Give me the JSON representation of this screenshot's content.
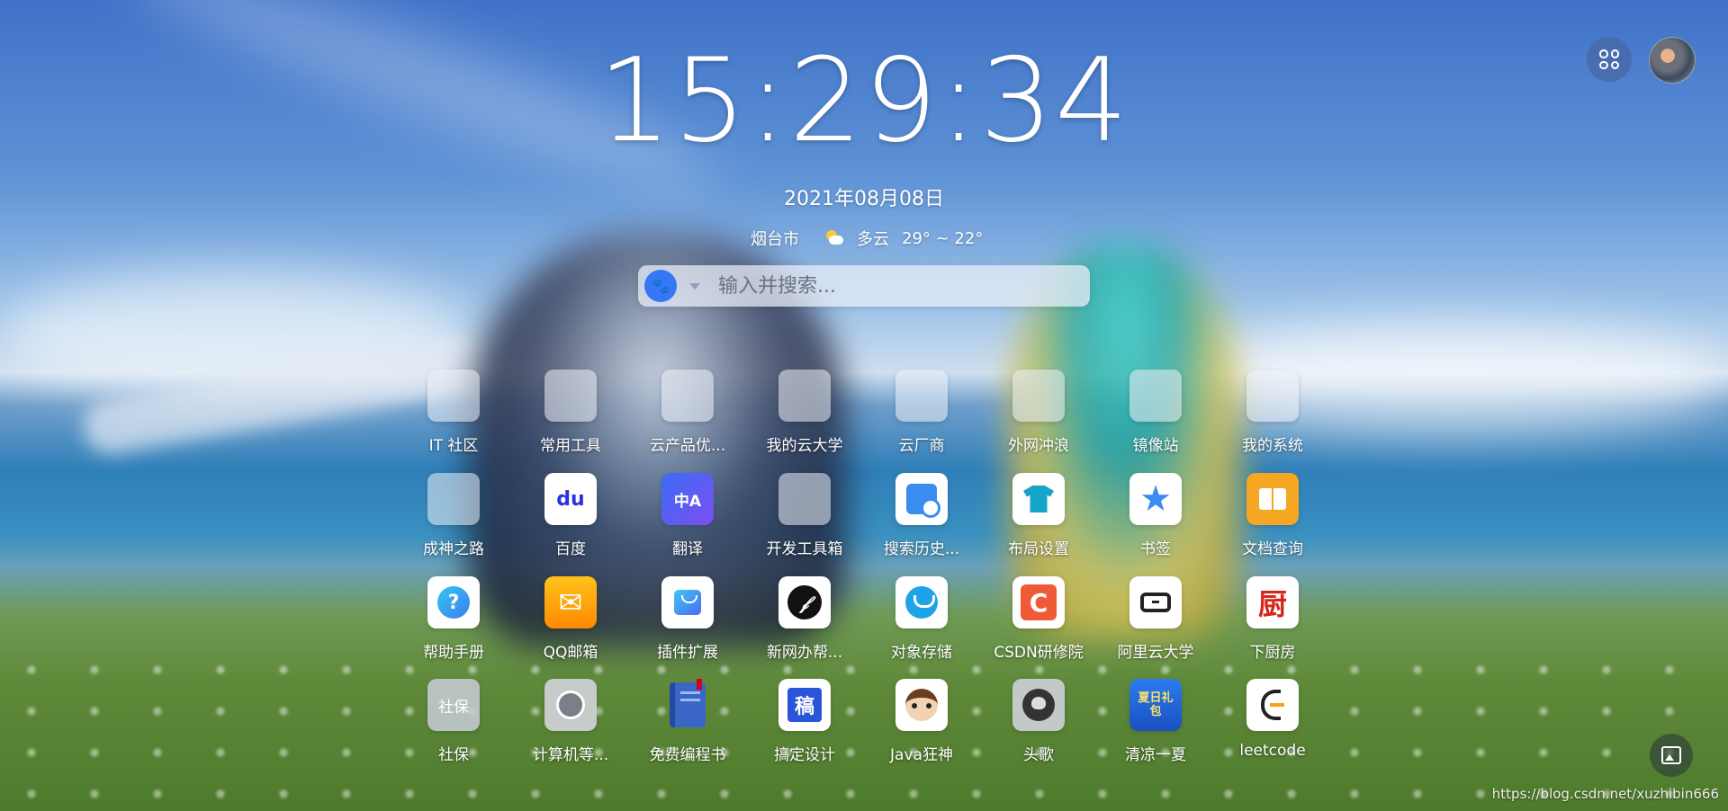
{
  "clock": {
    "time": "15:29:34"
  },
  "date": "2021年08月08日",
  "weather": {
    "city": "烟台市",
    "condition": "多云",
    "temps": "29° ~ 22°",
    "icon": "partly-cloudy-icon"
  },
  "search": {
    "placeholder": "输入并搜索...",
    "value": "",
    "engine_icon": "baidu-paw-icon"
  },
  "header": {
    "apps_icon": "apps-grid-icon",
    "avatar": "user-avatar"
  },
  "tiles": [
    {
      "label": "IT 社区"
    },
    {
      "label": "常用工具"
    },
    {
      "label": "云产品优..."
    },
    {
      "label": "我的云大学"
    },
    {
      "label": "云厂商"
    },
    {
      "label": "外网冲浪"
    },
    {
      "label": "镜像站"
    },
    {
      "label": "我的系统"
    },
    {
      "label": "成神之路"
    },
    {
      "label": "百度",
      "glyph": "du"
    },
    {
      "label": "翻译",
      "glyph": "中A"
    },
    {
      "label": "开发工具箱"
    },
    {
      "label": "搜索历史..."
    },
    {
      "label": "布局设置"
    },
    {
      "label": "书签",
      "glyph": "★"
    },
    {
      "label": "文档查询"
    },
    {
      "label": "帮助手册",
      "glyph": "?"
    },
    {
      "label": "QQ邮箱",
      "glyph": "✉"
    },
    {
      "label": "插件扩展"
    },
    {
      "label": "新网办帮..."
    },
    {
      "label": "对象存储"
    },
    {
      "label": "CSDN研修院",
      "glyph": "C"
    },
    {
      "label": "阿里云大学"
    },
    {
      "label": "下厨房",
      "glyph": "厨"
    },
    {
      "label": "社保",
      "glyph": "社保"
    },
    {
      "label": "计算机等..."
    },
    {
      "label": "免费编程书"
    },
    {
      "label": "搞定设计",
      "glyph": "稿"
    },
    {
      "label": "Java狂神"
    },
    {
      "label": "头歌"
    },
    {
      "label": "清凉一夏",
      "glyph": "夏日礼包"
    },
    {
      "label": "leetcode"
    }
  ],
  "footer": {
    "watermark": "https://blog.csdn.net/xuzhibin666",
    "wallpaper_icon": "wallpaper-icon"
  },
  "colors": {
    "engine": "#3578f6",
    "qq_mail": "#ff9a1a",
    "csdn": "#ef5b36",
    "docs": "#f5a623",
    "help": "#33a4f0"
  }
}
